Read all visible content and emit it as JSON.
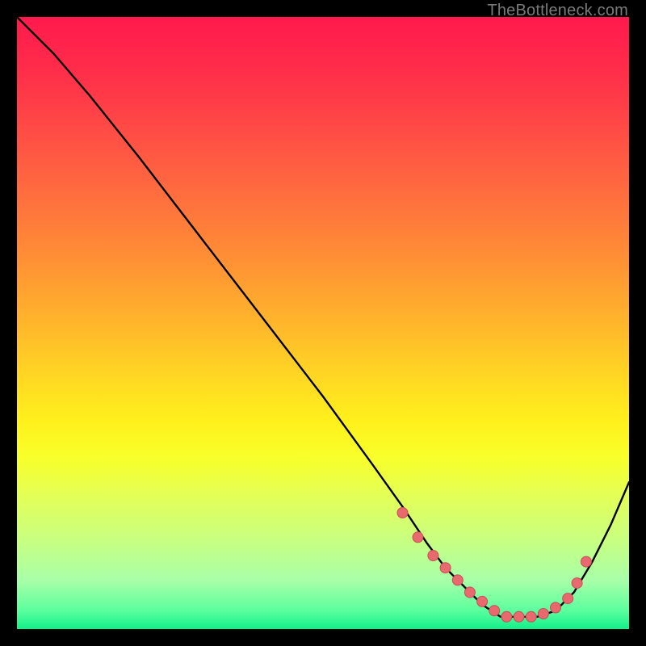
{
  "attribution": "TheBottleneck.com",
  "colors": {
    "frame": "#000000",
    "curve": "#000000",
    "marker_fill": "#e86a6f",
    "marker_stroke": "#c94e55"
  },
  "chart_data": {
    "type": "line",
    "title": "",
    "xlabel": "",
    "ylabel": "",
    "xlim": [
      0,
      100
    ],
    "ylim": [
      0,
      100
    ],
    "grid": false,
    "legend": false,
    "series": [
      {
        "name": "bottleneck-curve",
        "x": [
          0,
          6,
          12,
          20,
          30,
          40,
          50,
          58,
          63,
          67,
          70,
          73,
          76,
          79,
          82,
          85,
          88,
          91,
          94,
          97,
          100
        ],
        "y": [
          100,
          94,
          87,
          77,
          64,
          51,
          38,
          27,
          20,
          14,
          10,
          7,
          4,
          2,
          2,
          2,
          3,
          6,
          11,
          17,
          24
        ]
      }
    ],
    "markers": {
      "name": "optimal-zone-dots",
      "x": [
        63,
        65.5,
        68,
        70,
        72,
        74,
        76,
        78,
        80,
        82,
        84,
        86,
        88,
        90,
        91.5,
        93
      ],
      "y": [
        19,
        15,
        12,
        10,
        8,
        6,
        4.5,
        3,
        2,
        2,
        2,
        2.5,
        3.5,
        5,
        7.5,
        11
      ]
    }
  }
}
